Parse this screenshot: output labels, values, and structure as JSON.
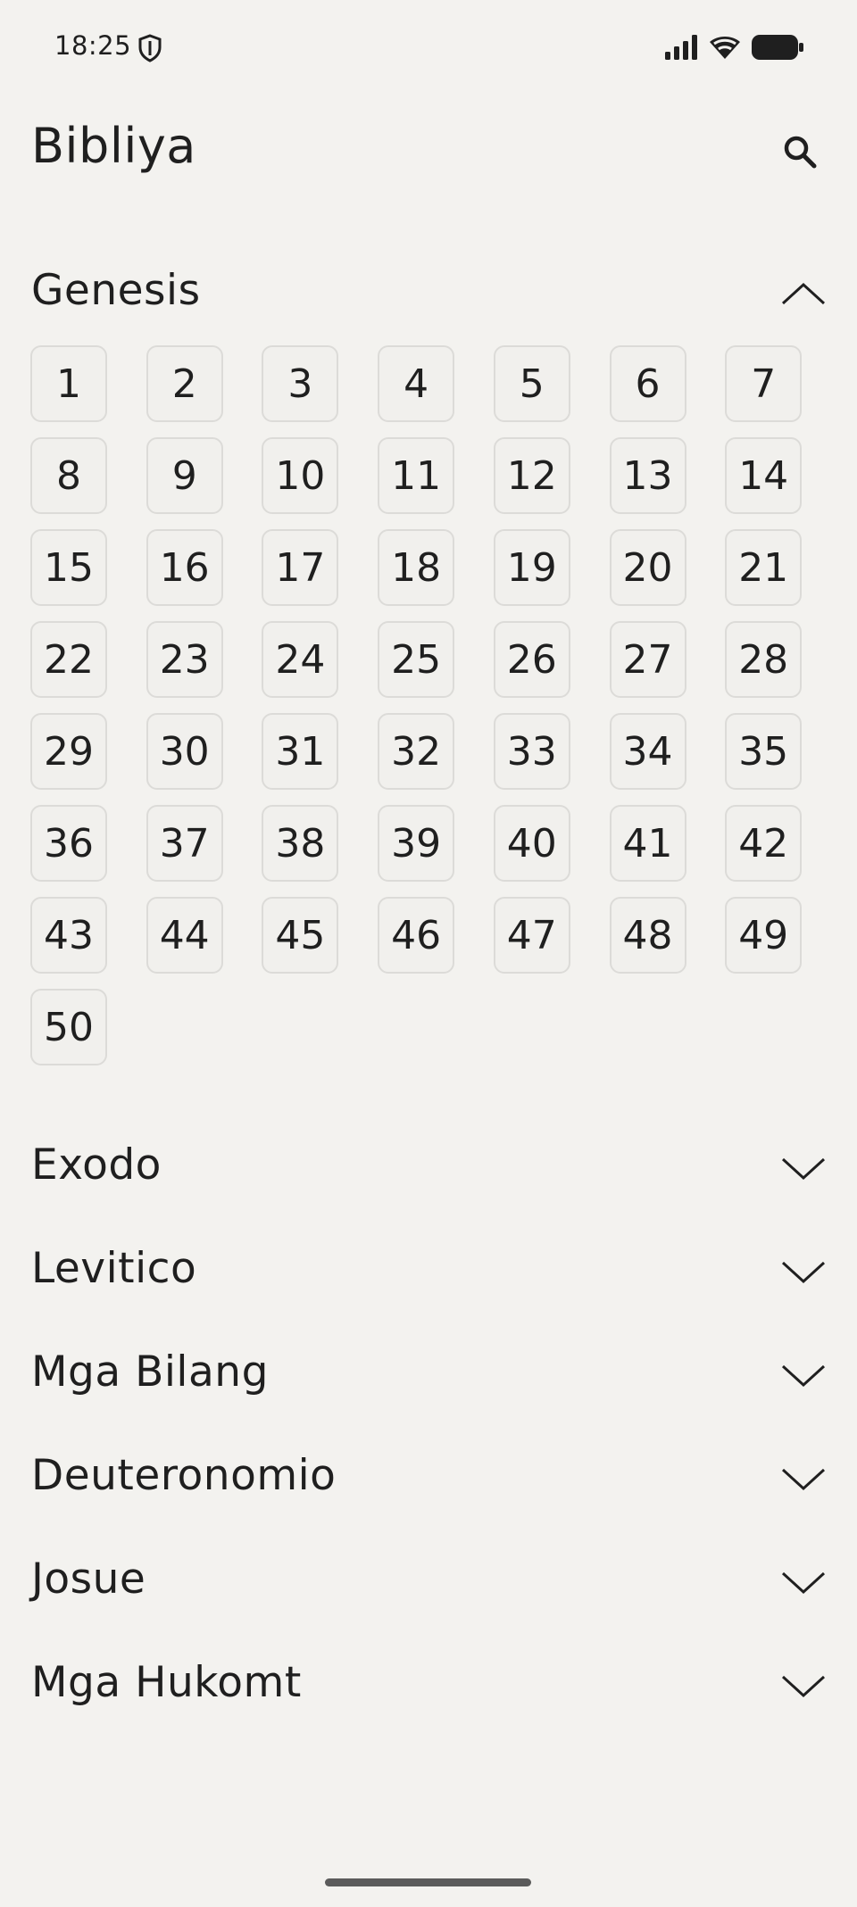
{
  "status_bar": {
    "time": "18:25",
    "icons": [
      "shield-icon",
      "signal-icon",
      "wifi-icon",
      "battery-icon"
    ]
  },
  "app_bar": {
    "title": "Bibliya",
    "search_icon": "search-icon"
  },
  "books": [
    {
      "name": "Genesis",
      "expanded": true,
      "chapters": [
        "1",
        "2",
        "3",
        "4",
        "5",
        "6",
        "7",
        "8",
        "9",
        "10",
        "11",
        "12",
        "13",
        "14",
        "15",
        "16",
        "17",
        "18",
        "19",
        "20",
        "21",
        "22",
        "23",
        "24",
        "25",
        "26",
        "27",
        "28",
        "29",
        "30",
        "31",
        "32",
        "33",
        "34",
        "35",
        "36",
        "37",
        "38",
        "39",
        "40",
        "41",
        "42",
        "43",
        "44",
        "45",
        "46",
        "47",
        "48",
        "49",
        "50"
      ]
    },
    {
      "name": "Exodo",
      "expanded": false
    },
    {
      "name": "Levitico",
      "expanded": false
    },
    {
      "name": "Mga Bilang",
      "expanded": false
    },
    {
      "name": "Deuteronomio",
      "expanded": false
    },
    {
      "name": "Josue",
      "expanded": false
    },
    {
      "name": "Mga Hukomt",
      "expanded": false
    }
  ],
  "colors": {
    "background": "#f3f2ef",
    "text": "#1f1f1f",
    "chapter_border": "#dcdbd8"
  }
}
